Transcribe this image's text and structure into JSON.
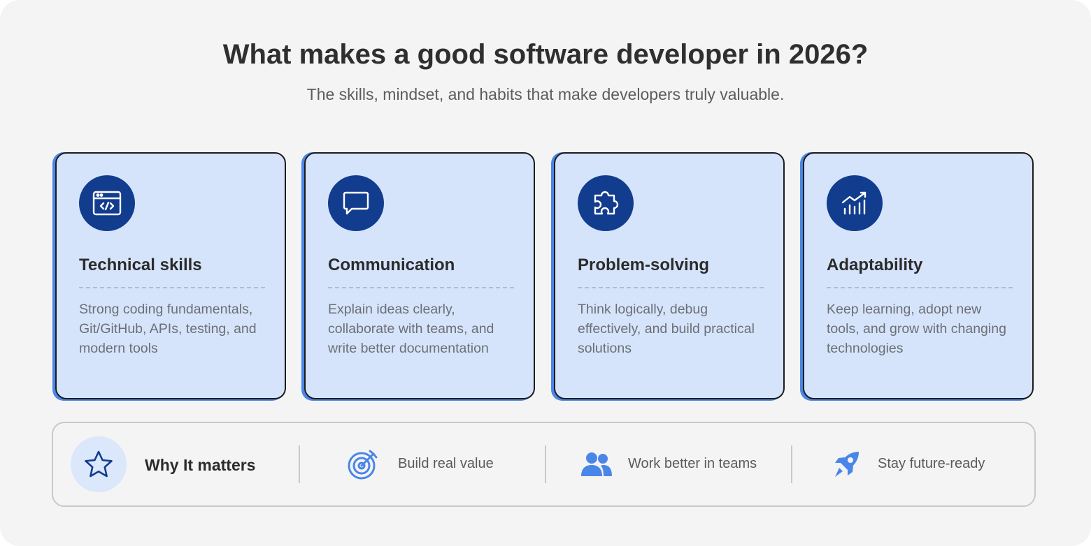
{
  "header": {
    "title": "What makes a good software developer in 2026?",
    "subtitle": "The skills, mindset, and habits that make developers truly valuable."
  },
  "cards": [
    {
      "icon": "code-window-icon",
      "title": "Technical skills",
      "desc": "Strong coding fundamentals, Git/GitHub, APIs, testing, and modern tools"
    },
    {
      "icon": "chat-bubble-icon",
      "title": "Communication",
      "desc": "Explain ideas clearly, collaborate with teams, and write better documentation"
    },
    {
      "icon": "puzzle-icon",
      "title": "Problem-solving",
      "desc": "Think logically, debug effectively, and build practical solutions"
    },
    {
      "icon": "growth-chart-icon",
      "title": "Adaptability",
      "desc": "Keep learning, adopt new tools, and grow with changing technologies"
    }
  ],
  "why": {
    "label": "Why It matters",
    "items": [
      {
        "icon": "target-icon",
        "label": "Build real value"
      },
      {
        "icon": "team-icon",
        "label": "Work better in teams"
      },
      {
        "icon": "rocket-icon",
        "label": "Stay future-ready"
      }
    ]
  },
  "colors": {
    "card_bg": "#d6e4fb",
    "card_accent": "#4a86e8",
    "icon_circle": "#123c8e",
    "page_bg": "#f4f4f4"
  }
}
